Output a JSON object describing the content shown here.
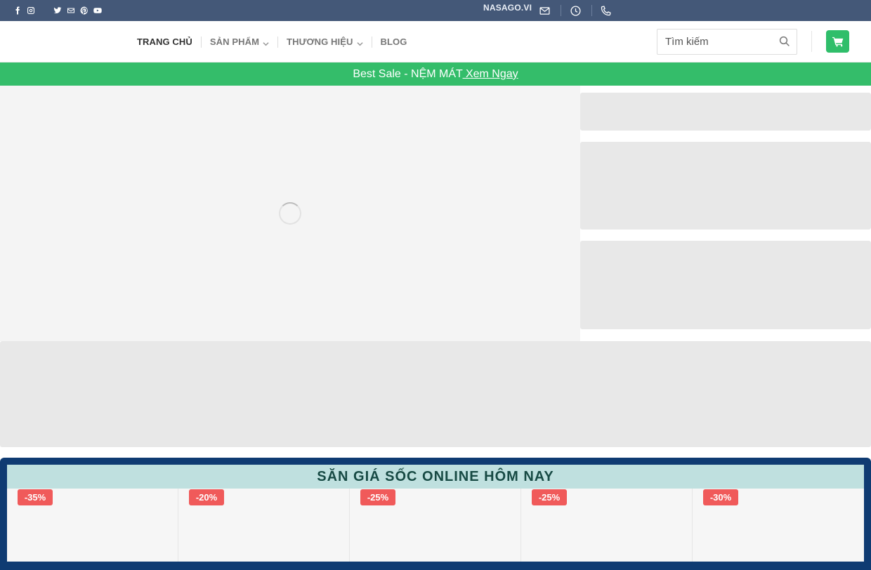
{
  "topbar": {
    "social_icons": [
      "facebook-icon",
      "instagram-icon",
      "twitter-icon",
      "email-icon",
      "pinterest-icon",
      "youtube-icon"
    ],
    "site_label": "NASAGO.VI",
    "contact_icons": [
      "envelope-icon",
      "clock-icon",
      "phone-icon"
    ],
    "background": "#445878"
  },
  "nav": {
    "items": [
      {
        "label": "TRANG CHỦ",
        "active": true,
        "dropdown": false
      },
      {
        "label": "SẢN PHẨM",
        "active": false,
        "dropdown": true
      },
      {
        "label": "THƯƠNG HIỆU",
        "active": false,
        "dropdown": true
      },
      {
        "label": "BLOG",
        "active": false,
        "dropdown": false
      }
    ]
  },
  "search": {
    "placeholder": "Tìm kiếm",
    "value": ""
  },
  "cart": {
    "icon": "cart-icon",
    "color": "#2fbe6a"
  },
  "promo": {
    "text": "Best Sale - NỆM MÁT",
    "link": " Xem Ngay",
    "background": "#34bd6a"
  },
  "flash_sale": {
    "title": "SĂN GIÁ SỐC ONLINE HÔM NAY",
    "background": "#0f3b72",
    "badge_color": "#f05a5a",
    "products": [
      {
        "discount": "-35%"
      },
      {
        "discount": "-20%"
      },
      {
        "discount": "-25%"
      },
      {
        "discount": "-25%"
      },
      {
        "discount": "-30%"
      }
    ]
  }
}
